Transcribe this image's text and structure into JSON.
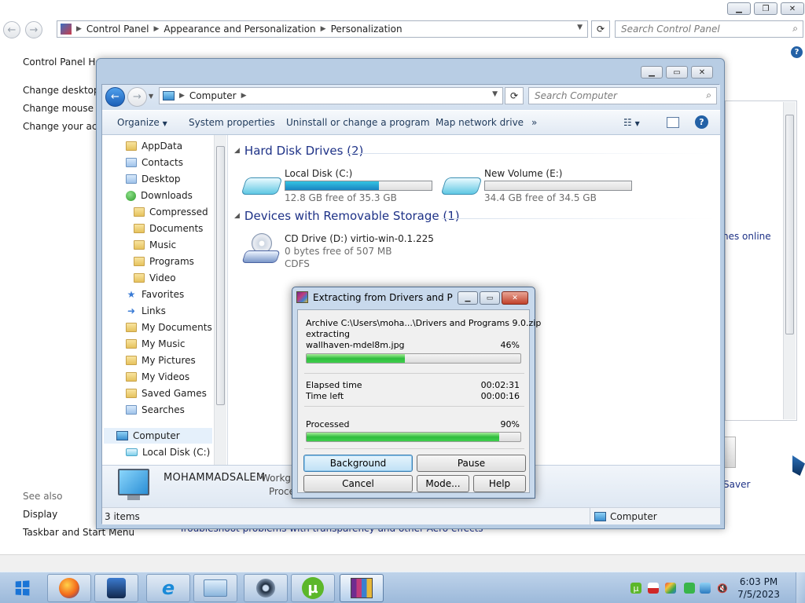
{
  "control_panel": {
    "breadcrumb": [
      "Control Panel",
      "Appearance and Personalization",
      "Personalization"
    ],
    "search_placeholder": "Search Control Panel",
    "left_links": [
      "Control Panel Hom",
      "Change desktop i",
      "Change mouse po",
      "Change your acco"
    ],
    "see_also_title": "See also",
    "see_also_links": [
      "Display",
      "Taskbar and Start Menu"
    ],
    "right_link_fragment": "nes online",
    "right_label_fragment": "Saver",
    "troubleshoot_text": "Troubleshoot problems with transparency and other Aero effects"
  },
  "explorer": {
    "address": [
      "Computer"
    ],
    "search_placeholder": "Search Computer",
    "toolbar": [
      "Organize",
      "System properties",
      "Uninstall or change a program",
      "Map network drive",
      "»"
    ],
    "nav_items": [
      "AppData",
      "Contacts",
      "Desktop",
      "Downloads",
      "Compressed",
      "Documents",
      "Music",
      "Programs",
      "Video",
      "Favorites",
      "Links",
      "My Documents",
      "My Music",
      "My Pictures",
      "My Videos",
      "Saved Games",
      "Searches",
      "Computer",
      "Local Disk (C:)"
    ],
    "groups": {
      "hard_disks": "Hard Disk Drives (2)",
      "removable": "Devices with Removable Storage (1)"
    },
    "drives": [
      {
        "name": "Local Disk (C:)",
        "free": "12.8 GB free of 35.3 GB",
        "used_fraction": 0.64
      },
      {
        "name": "New Volume (E:)",
        "free": "34.4 GB free of 34.5 GB",
        "used_fraction": 0.0
      }
    ],
    "cd_drive": {
      "name": "CD Drive (D:) virtio-win-0.1.225",
      "free": "0 bytes free of 507 MB",
      "fs": "CDFS"
    },
    "details": {
      "computer_name": "MOHAMMADSALEM",
      "workgroup_fragment": "Workgr",
      "processor_fragment": "Proce"
    },
    "status": {
      "count": "3 items",
      "location": "Computer"
    }
  },
  "dialog": {
    "title": "Extracting from Drivers and Pro...",
    "archive": "Archive C:\\Users\\moha...\\Drivers and Programs 9.0.zip",
    "action": "extracting",
    "current_file": "wallhaven-mdel8m.jpg",
    "file_percent": "46%",
    "file_progress": 0.46,
    "elapsed_label": "Elapsed time",
    "elapsed_value": "00:02:31",
    "timeleft_label": "Time left",
    "timeleft_value": "00:00:16",
    "processed_label": "Processed",
    "processed_percent": "90%",
    "processed_progress": 0.9,
    "buttons": {
      "background": "Background",
      "pause": "Pause",
      "cancel": "Cancel",
      "mode": "Mode...",
      "help": "Help"
    }
  },
  "taskbar": {
    "time": "6:03 PM",
    "date": "7/5/2023"
  }
}
